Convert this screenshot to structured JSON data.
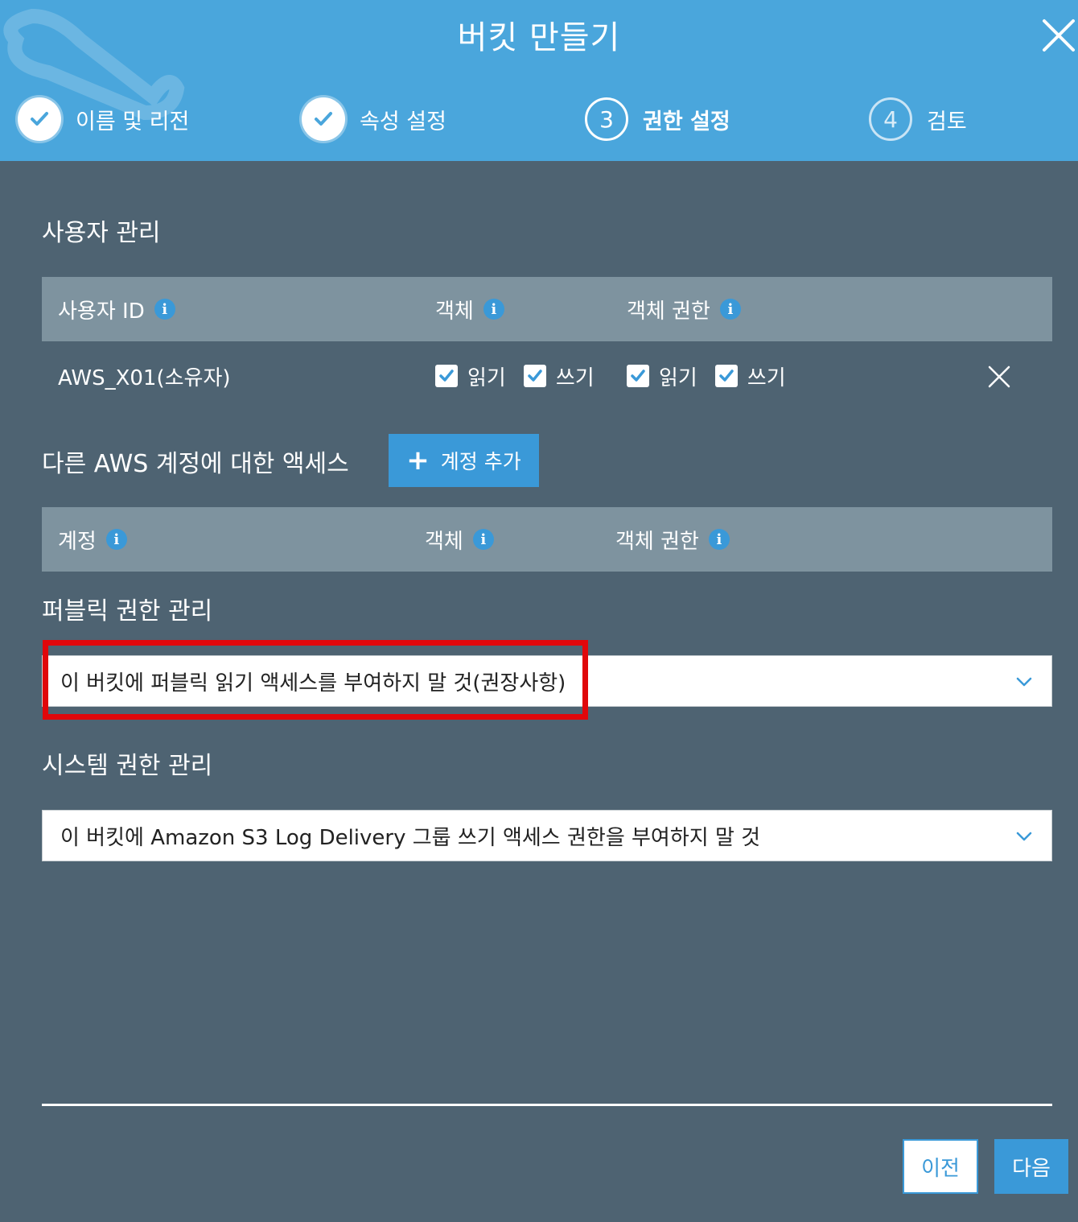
{
  "header": {
    "title": "버킷 만들기",
    "steps": [
      {
        "label": "이름 및 리전",
        "state": "done"
      },
      {
        "label": "속성 설정",
        "state": "done"
      },
      {
        "number": "3",
        "label": "권한 설정",
        "state": "active"
      },
      {
        "number": "4",
        "label": "검토",
        "state": "pending"
      }
    ]
  },
  "user_management": {
    "title": "사용자 관리",
    "columns": [
      "사용자 ID",
      "객체",
      "객체 권한"
    ],
    "rows": [
      {
        "user_id": "AWS_X01(소유자)",
        "object": {
          "read": "읽기",
          "write": "쓰기",
          "read_checked": true,
          "write_checked": true
        },
        "object_permission": {
          "read": "읽기",
          "write": "쓰기",
          "read_checked": true,
          "write_checked": true
        }
      }
    ]
  },
  "other_accounts": {
    "title": "다른 AWS 계정에 대한 액세스",
    "add_button": "계정 추가",
    "columns": [
      "계정",
      "객체",
      "객체 권한"
    ]
  },
  "public_permissions": {
    "title": "퍼블릭 권한 관리",
    "selected": "이 버킷에 퍼블릭 읽기 액세스를 부여하지 말 것(권장사항)"
  },
  "system_permissions": {
    "title": "시스템 권한 관리",
    "selected": "이 버킷에 Amazon S3 Log Delivery 그룹 쓰기 액세스 권한을 부여하지 말 것"
  },
  "footer": {
    "prev": "이전",
    "next": "다음"
  },
  "colors": {
    "header_bg": "#4aa6dc",
    "body_bg": "#4e6372",
    "table_head_bg": "#7e939f",
    "accent": "#3a99d8",
    "highlight": "#e0070b"
  }
}
